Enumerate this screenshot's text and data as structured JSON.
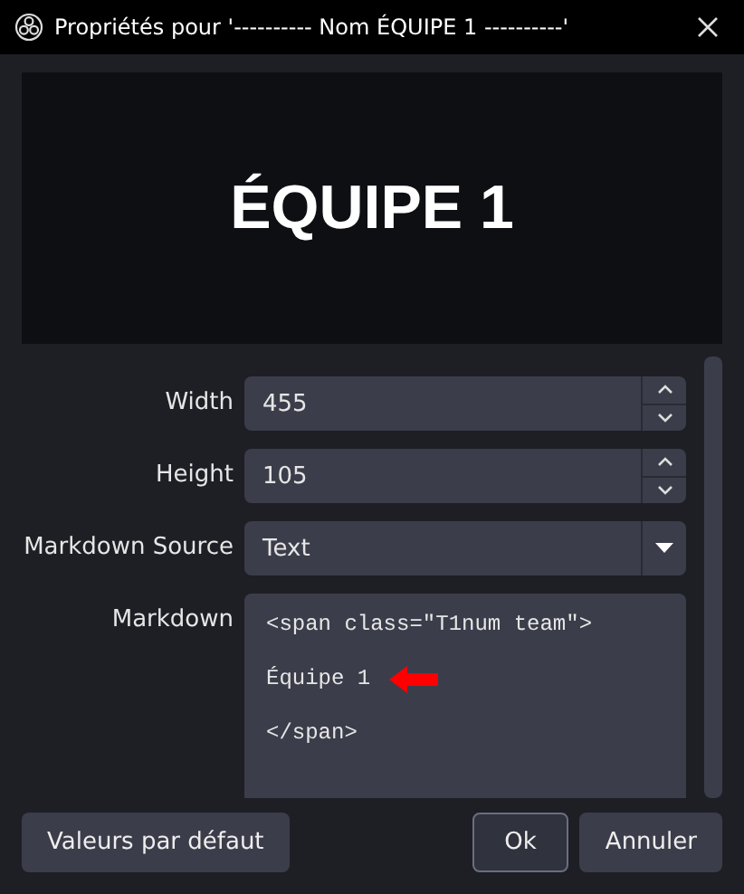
{
  "window": {
    "title": "Propriétés pour '---------- Nom ÉQUIPE 1 ----------'"
  },
  "preview": {
    "text": "ÉQUIPE 1"
  },
  "fields": [
    {
      "kind": "spin",
      "label": "Width",
      "value": "455"
    },
    {
      "kind": "spin",
      "label": "Height",
      "value": "105"
    },
    {
      "kind": "dropdown",
      "label": "Markdown Source",
      "value": "Text"
    },
    {
      "kind": "textarea",
      "label": "Markdown",
      "lines": [
        {
          "text": "<span class=\"T1num team\">",
          "arrow": false
        },
        {
          "text": "Équipe 1",
          "arrow": true
        },
        {
          "text": "</span>",
          "arrow": false
        }
      ]
    }
  ],
  "buttons_left": [
    {
      "label": "Valeurs par défaut",
      "focused": false
    }
  ],
  "buttons_right": [
    {
      "label": "Ok",
      "focused": true
    },
    {
      "label": "Annuler",
      "focused": false
    }
  ]
}
